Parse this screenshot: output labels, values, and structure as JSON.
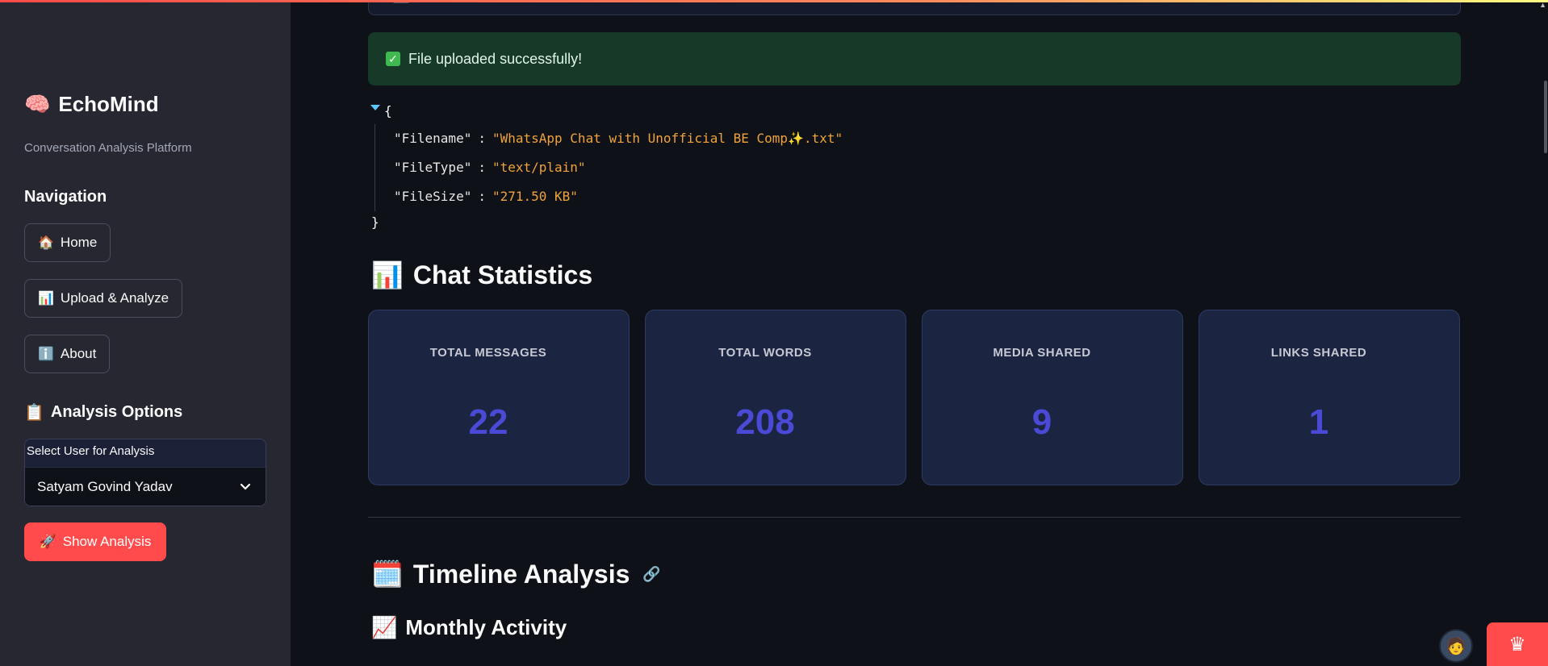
{
  "app": {
    "brand": "EchoMind",
    "brand_icon": "brain-icon",
    "subtitle": "Conversation Analysis Platform"
  },
  "sidebar": {
    "nav_heading": "Navigation",
    "nav_items": [
      {
        "label": "Home",
        "icon": "🏠"
      },
      {
        "label": "Upload & Analyze",
        "icon": "📊"
      },
      {
        "label": "About",
        "icon": "ℹ️"
      }
    ],
    "options_heading": "Analysis Options",
    "options_icon": "📋",
    "select_label": "Select User for Analysis",
    "select_value": "Satyam Govind Yadav",
    "show_button": "Show Analysis",
    "show_button_icon": "🚀"
  },
  "main": {
    "success_message": "File uploaded successfully!",
    "file_info": [
      {
        "key": "\"Filename\"",
        "value": "\"WhatsApp Chat with Unofficial BE Comp✨.txt\""
      },
      {
        "key": "\"FileType\"",
        "value": "\"text/plain\""
      },
      {
        "key": "\"FileSize\"",
        "value": "\"271.50 KB\""
      }
    ],
    "stats_heading": "Chat Statistics",
    "stats_icon": "📊",
    "metrics": [
      {
        "label": "TOTAL MESSAGES",
        "value": "22"
      },
      {
        "label": "TOTAL WORDS",
        "value": "208"
      },
      {
        "label": "MEDIA SHARED",
        "value": "9"
      },
      {
        "label": "LINKS SHARED",
        "value": "1"
      }
    ],
    "timeline_heading": "Timeline Analysis",
    "timeline_icon": "🗓️",
    "monthly_heading": "Monthly Activity",
    "monthly_icon": "📈"
  },
  "colors": {
    "accent": "#ff4b4b",
    "metric_value": "#4a4ad6",
    "json_value": "#f0a33c",
    "success_bg": "#173928"
  }
}
